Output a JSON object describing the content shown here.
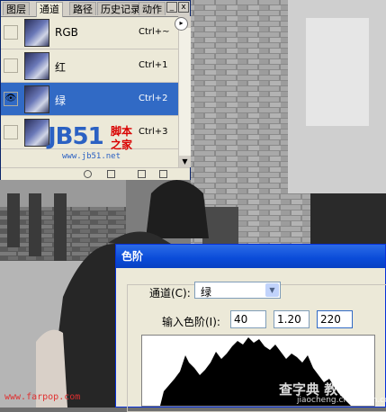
{
  "tabs": [
    "图层",
    "通道",
    "路径",
    "历史记录",
    "动作"
  ],
  "channels": [
    {
      "name": "RGB",
      "shortcut": "Ctrl+~",
      "visible": false,
      "selected": false
    },
    {
      "name": "红",
      "shortcut": "Ctrl+1",
      "visible": false,
      "selected": false
    },
    {
      "name": "绿",
      "shortcut": "Ctrl+2",
      "visible": true,
      "selected": true
    },
    {
      "name": "",
      "shortcut": "Ctrl+3",
      "visible": false,
      "selected": false
    }
  ],
  "panel_controls": {
    "minimize": "_",
    "close": "x",
    "menu": "▸"
  },
  "watermark": {
    "logo": "JB51",
    "line1": "脚本",
    "line2": "之家",
    "url": "www.jb51.net"
  },
  "levels_dialog": {
    "title": "色阶",
    "channel_label": "通道(C):",
    "channel_value": "绿",
    "input_label": "输入色阶(I):",
    "input_black": "40",
    "input_gamma": "1.20",
    "input_white": "220"
  },
  "credit": "www.farpop.com",
  "site_watermark": {
    "name": "查字典 教程网",
    "url": "jiaocheng.chazidian.com"
  },
  "colors": {
    "selection": "#316ac5",
    "dialog_title": "#0a4bd8",
    "watermark_blue": "#2b61c3",
    "watermark_red": "#d90000"
  }
}
